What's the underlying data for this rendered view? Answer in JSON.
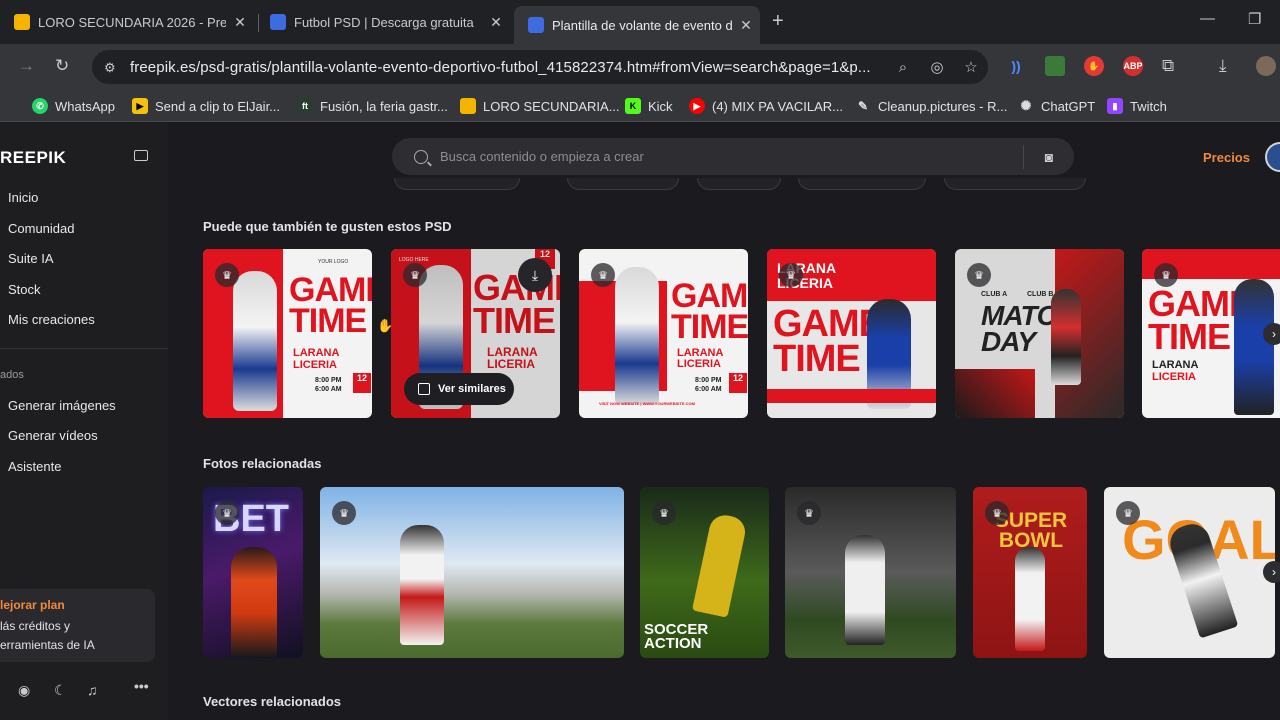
{
  "browser": {
    "tabs": [
      {
        "title": "LORO SECUNDARIA 2026 - Pre",
        "favicon_color": "#f4b400"
      },
      {
        "title": "Futbol PSD | Descarga gratuita",
        "favicon_color": "#3d6be0"
      },
      {
        "title": "Plantilla de volante de evento d",
        "favicon_color": "#3d6be0"
      }
    ],
    "address": "freepik.es/psd-gratis/plantilla-volante-evento-deportivo-futbol_415822374.htm#fromView=search&page=1&p...",
    "extensions": [
      {
        "name": "wifi-ext-icon",
        "label": "",
        "color": "#4b8cff"
      },
      {
        "name": "flag-ext-icon",
        "label": "",
        "color": "#d24b4b"
      },
      {
        "name": "hand-ext-icon",
        "label": "",
        "color": "#e53935"
      },
      {
        "name": "abp-ext-icon",
        "label": "ABP",
        "color": "#d32f2f"
      }
    ],
    "bookmarks": [
      {
        "label": "WhatsApp",
        "icon": "whatsapp-icon",
        "color": "#25d366"
      },
      {
        "label": "Send a clip to ElJair...",
        "icon": "clip-icon",
        "color": "#f4c20d"
      },
      {
        "label": "Fusión, la feria gastr...",
        "icon": "fusion-icon",
        "color": "#2a3b2f"
      },
      {
        "label": "LORO SECUNDARIA...",
        "icon": "slides-icon",
        "color": "#f4b400"
      },
      {
        "label": "Kick",
        "icon": "kick-icon",
        "color": "#53fc18"
      },
      {
        "label": "(4) MIX PA VACILAR...",
        "icon": "youtube-icon",
        "color": "#ff0000"
      },
      {
        "label": "Cleanup.pictures - R...",
        "icon": "cleanup-icon",
        "color": "#444444"
      },
      {
        "label": "ChatGPT",
        "icon": "chatgpt-icon",
        "color": "#555555"
      },
      {
        "label": "Twitch",
        "icon": "twitch-icon",
        "color": "#9146ff"
      }
    ]
  },
  "sidebar": {
    "logo": "REEPIK",
    "nav": [
      "Inicio",
      "Comunidad",
      "Suite IA",
      "Stock",
      "Mis creaciones"
    ],
    "section_label": "ados",
    "ai_items": [
      "Generar imágenes",
      "Generar vídeos",
      "Asistente"
    ],
    "plan": {
      "title": "lejorar plan",
      "line1": "lás créditos y",
      "line2": "erramientas de IA"
    }
  },
  "header": {
    "search_placeholder": "Busca contenido o empieza a crear",
    "pricing": "Precios"
  },
  "sections": {
    "psd_title": "Puede que también te gusten estos PSD",
    "photos_title": "Fotos relacionadas",
    "vectors_title": "Vectores relacionados"
  },
  "psd_cards": [
    {
      "headline": "GAME TIME",
      "team1": "LARANA",
      "team2": "LICERIA",
      "vs": "VS",
      "time1": "8:00 PM",
      "time2": "6:00 AM",
      "day": "12",
      "month": "FEB",
      "logo": "YOUR LOGO"
    },
    {
      "headline": "GAME TIME",
      "team1": "LARANA",
      "team2": "LICERIA",
      "vs": "VS",
      "time1": "8:00 PM",
      "time2": "6:00 AM",
      "day": "12",
      "month": "FEB",
      "logo": "LOGO HERE"
    },
    {
      "headline": "GAME TIME",
      "team1": "LARANA",
      "team2": "LICERIA",
      "vs": "VS",
      "time1": "8:00 PM",
      "time2": "6:00 AM",
      "day": "12",
      "month": "FEB",
      "logo": "YOUR LOGO",
      "footer": "VISIT NOW WEBSITE | WWW.YOURWEBSITE.COM"
    },
    {
      "headline": "GAME TIME",
      "team1": "LARANA",
      "team2": "LICERIA",
      "vs": "VS",
      "logo": "LOGO HERE"
    },
    {
      "headline": "MATCH DAY",
      "team1": "CLUB A",
      "team2": "CLUB B",
      "vs": "VS"
    },
    {
      "headline": "GAME TIME",
      "team1": "LARANA",
      "team2": "LICERIA",
      "vs": "VS",
      "logo": "YOUR LOGO"
    }
  ],
  "hover_actions": {
    "similar": "Ver similares"
  },
  "photos": [
    {
      "text": "BET"
    },
    {
      "text": ""
    },
    {
      "text": "SOCCER ACTION"
    },
    {
      "text": ""
    },
    {
      "text": "SUPER BOWL"
    },
    {
      "text": "GOAL"
    }
  ],
  "colors": {
    "accent": "#f08a3a",
    "brand_red": "#e0141e"
  }
}
